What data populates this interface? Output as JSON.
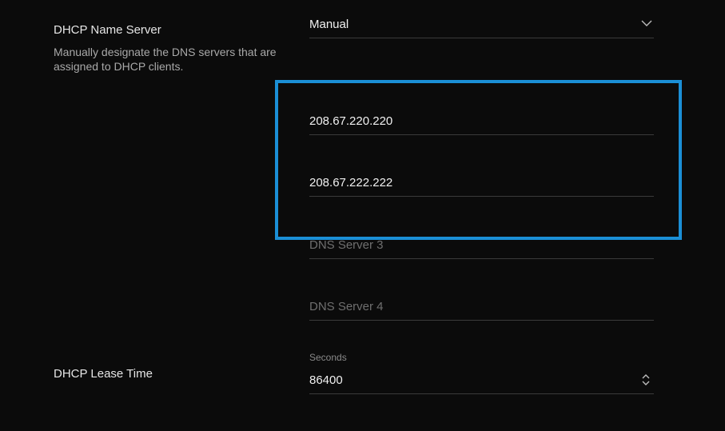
{
  "name_server": {
    "label": "DHCP Name Server",
    "description": "Manually designate the DNS servers that are assigned to DHCP clients.",
    "mode_value": "Manual",
    "dns_servers": [
      {
        "value": "208.67.220.220",
        "placeholder": ""
      },
      {
        "value": "208.67.222.222",
        "placeholder": ""
      },
      {
        "value": "",
        "placeholder": "DNS Server 3"
      },
      {
        "value": "",
        "placeholder": "DNS Server 4"
      }
    ]
  },
  "lease_time": {
    "label": "DHCP Lease Time",
    "unit_label": "Seconds",
    "value": "86400"
  },
  "colors": {
    "background": "#0b0b0b",
    "highlight": "#1b8fd6",
    "divider": "#3a3a3a"
  },
  "icons": {
    "mode_dropdown": "chevron-down-icon",
    "lease_stepper": "stepper-icon"
  }
}
